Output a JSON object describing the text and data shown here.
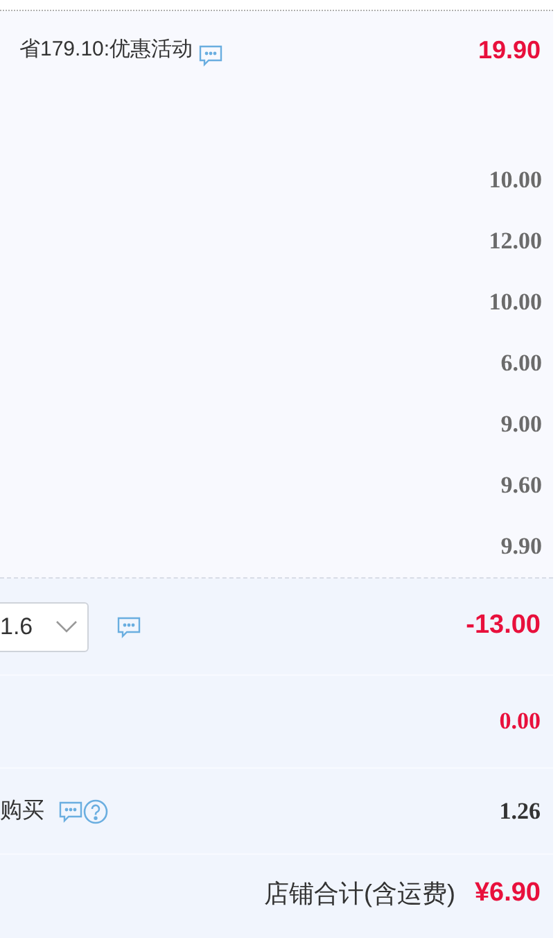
{
  "promotion": {
    "label": "省179.10:优惠活动",
    "amount": "19.90"
  },
  "item_prices": [
    "10.00",
    "12.00",
    "10.00",
    "6.00",
    "9.00",
    "9.60",
    "9.90"
  ],
  "coupon": {
    "value": "1.6",
    "amount": "-13.00"
  },
  "shipping": {
    "amount": "0.00"
  },
  "purchase": {
    "label": "购买",
    "amount": "1.26"
  },
  "total": {
    "label": "店铺合计(含运费)",
    "amount": "¥6.90"
  }
}
